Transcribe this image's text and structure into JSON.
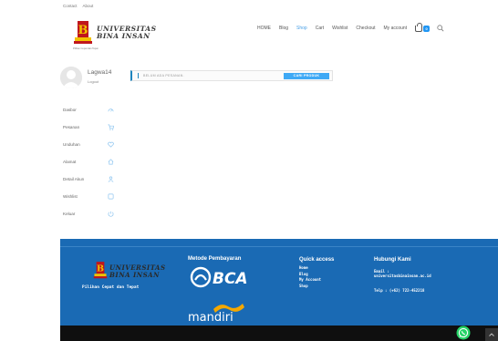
{
  "topbar": {
    "contact": "Contact",
    "about": "About"
  },
  "brand": {
    "line1": "UNIVERSITAS",
    "line2": "BINA INSAN",
    "tagline": "Pilihan Cepat dan Tepat"
  },
  "nav": {
    "items": [
      "HOME",
      "Blog",
      "Shop",
      "Cart",
      "Wishlist",
      "Checkout",
      "My account"
    ],
    "active_index": 2,
    "cart_count": "0"
  },
  "user": {
    "name": "Lagwa14",
    "logout": "Logout"
  },
  "notice": {
    "text": "BELUM ADA PESANAN.",
    "button": "CARI PRODUK"
  },
  "account_menu": [
    {
      "label": "Dasbor",
      "icon": "dashboard-icon"
    },
    {
      "label": "Pesanan",
      "icon": "cart-icon"
    },
    {
      "label": "Unduhan",
      "icon": "heart-icon"
    },
    {
      "label": "Alamat",
      "icon": "home-icon"
    },
    {
      "label": "Detail Akun",
      "icon": "user-icon"
    },
    {
      "label": "Wishlist",
      "icon": "wishlist-icon"
    },
    {
      "label": "Keluar",
      "icon": "logout-icon"
    }
  ],
  "footer": {
    "payment_heading": "Metode Pembayaran",
    "bank1": "BCA",
    "bank2": "mandiri",
    "quick_heading": "Quick access",
    "quick_links": [
      "Home",
      "Blog",
      "My Account",
      "Shop"
    ],
    "contact_heading": "Hubungi Kami",
    "email_label": "Email :",
    "email_value": "universitasbinainsan.ac.id",
    "phone": "Telp : (+62) 722-452218"
  },
  "colors": {
    "accent": "#3fa9f5",
    "footer": "#1a6ab4",
    "logo_red": "#c0161c",
    "logo_yellow": "#f2c200"
  }
}
